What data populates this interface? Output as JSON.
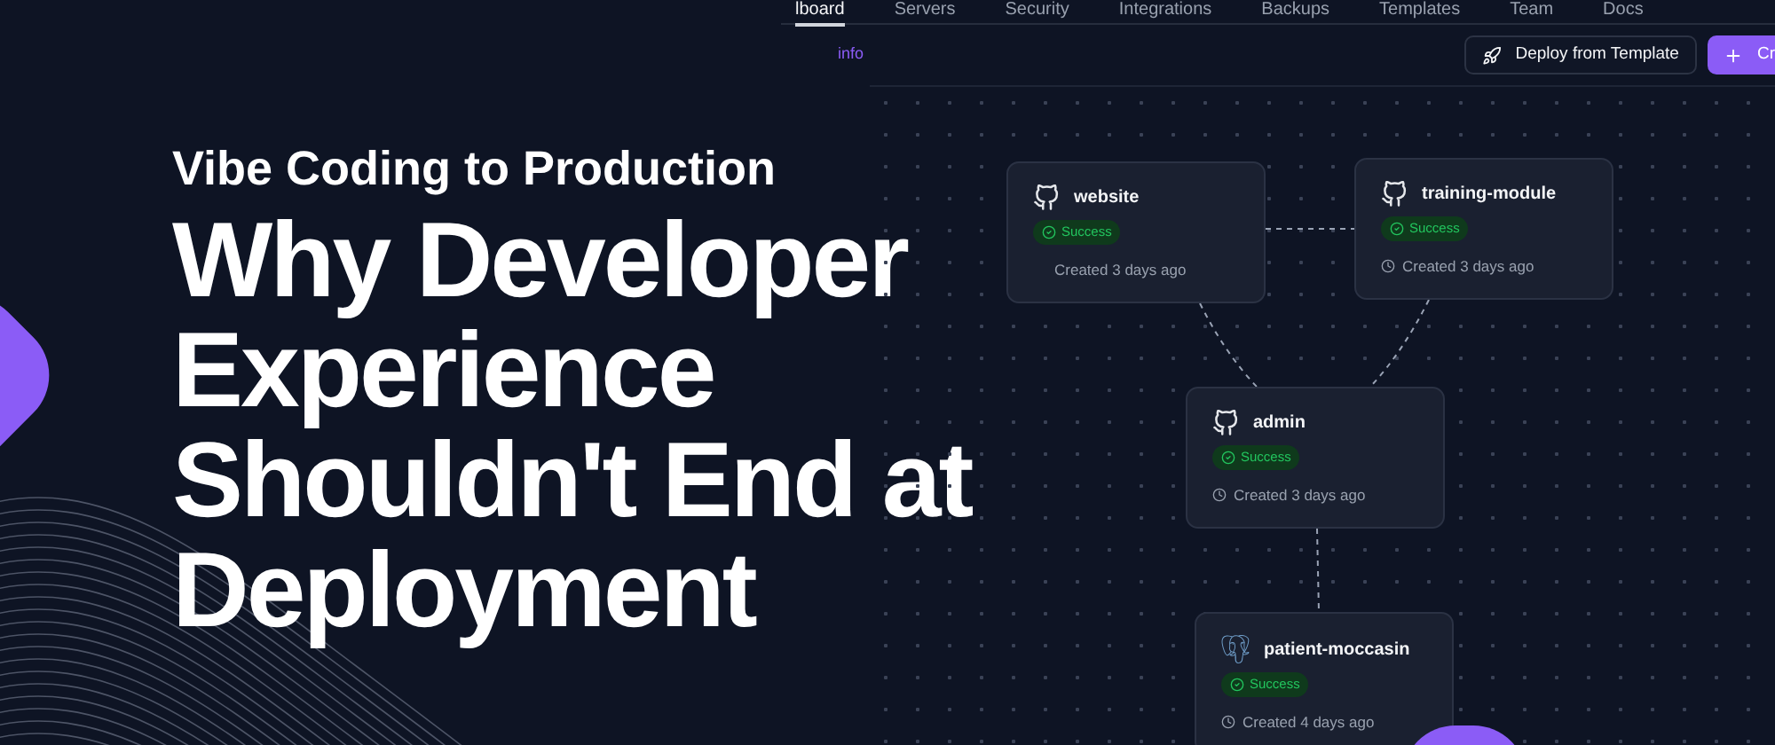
{
  "headline": {
    "kicker": "Vibe Coding to Production",
    "title": "Why Developer Experience Shouldn't End at Deployment"
  },
  "app": {
    "tabs": [
      {
        "label": "lboard",
        "selected": true
      },
      {
        "label": "Servers",
        "selected": false
      },
      {
        "label": "Security",
        "selected": false
      },
      {
        "label": "Integrations",
        "selected": false
      },
      {
        "label": "Backups",
        "selected": false
      },
      {
        "label": "Templates",
        "selected": false
      },
      {
        "label": "Team",
        "selected": false
      },
      {
        "label": "Docs",
        "selected": false
      }
    ],
    "info_link": "info",
    "buttons": [
      {
        "kind": "template",
        "label": "Deploy from Template"
      },
      {
        "kind": "create",
        "label": "Cr"
      }
    ],
    "nodes": [
      {
        "kind": "github",
        "name": "website",
        "status": "Success",
        "created": "Created 3 days ago",
        "clock": false
      },
      {
        "kind": "github",
        "name": "training-module",
        "status": "Success",
        "created": "Created 3 days ago",
        "clock": true
      },
      {
        "kind": "github",
        "name": "admin",
        "status": "Success",
        "created": "Created 3 days ago",
        "clock": true
      },
      {
        "kind": "database",
        "name": "patient-moccasin",
        "status": "Success",
        "created": "Created 4 days ago",
        "clock": true
      }
    ]
  }
}
